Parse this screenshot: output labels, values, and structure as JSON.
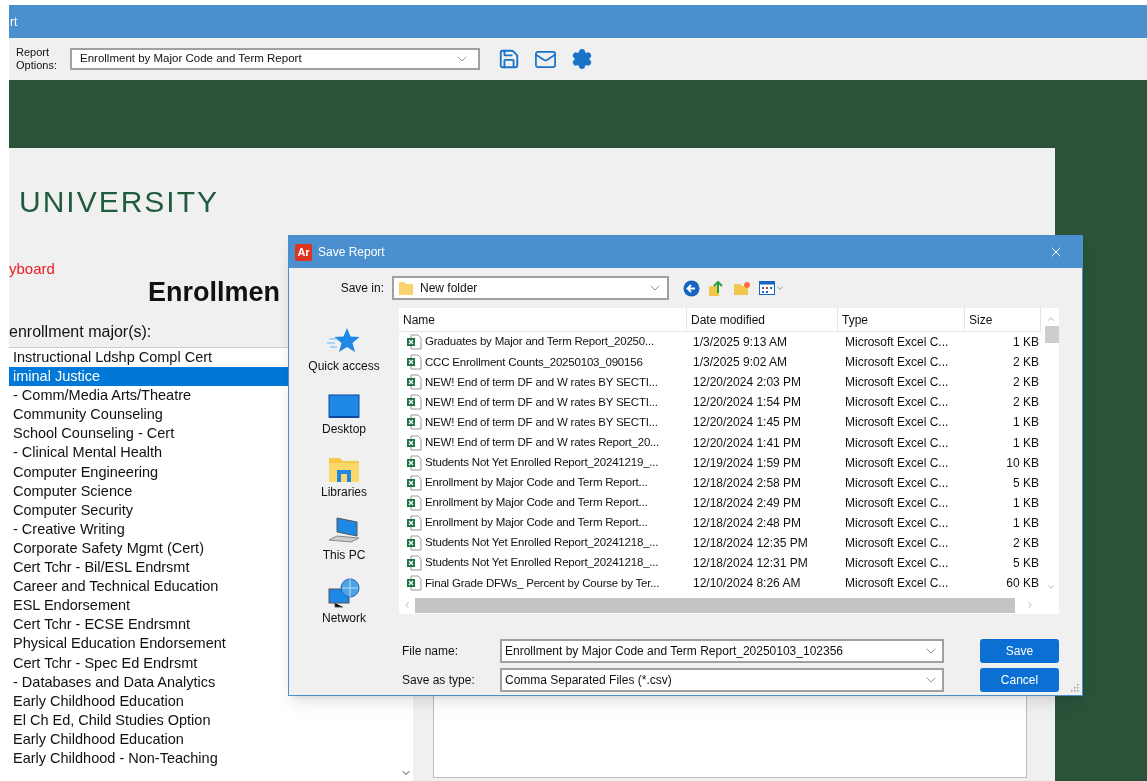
{
  "window": {
    "title": "rt"
  },
  "toolbar": {
    "report_options_label": "Report Options:",
    "report_select": "Enrollment by Major Code and Term Report"
  },
  "page": {
    "heading": "UNIVERSITY",
    "link": "yboard",
    "title": "Enrollmen",
    "majors_label": "enrollment major(s):",
    "majors": [
      {
        "label": "Instructional Ldshp Compl Cert",
        "selected": false
      },
      {
        "label": "iminal Justice",
        "selected": true
      },
      {
        "label": "- Comm/Media Arts/Theatre",
        "selected": false
      },
      {
        "label": "Community Counseling",
        "selected": false
      },
      {
        "label": "School Counseling - Cert",
        "selected": false
      },
      {
        "label": "- Clinical Mental Health",
        "selected": false
      },
      {
        "label": "Computer Engineering",
        "selected": false
      },
      {
        "label": "Computer Science",
        "selected": false
      },
      {
        "label": "Computer Security",
        "selected": false
      },
      {
        "label": "- Creative Writing",
        "selected": false
      },
      {
        "label": "Corporate Safety Mgmt (Cert)",
        "selected": false
      },
      {
        "label": "Cert Tchr - Bil/ESL Endrsmt",
        "selected": false
      },
      {
        "label": "Career and Technical Education",
        "selected": false
      },
      {
        "label": "ESL Endorsement",
        "selected": false
      },
      {
        "label": "Cert Tchr - ECSE Endrsmnt",
        "selected": false
      },
      {
        "label": "Physical Education Endorsement",
        "selected": false
      },
      {
        "label": "Cert Tchr - Spec Ed Endrsmt",
        "selected": false
      },
      {
        "label": "- Databases and Data Analytics",
        "selected": false
      },
      {
        "label": "Early Childhood Education",
        "selected": false
      },
      {
        "label": "El Ch Ed, Child Studies Option",
        "selected": false
      },
      {
        "label": "Early Childhood Education",
        "selected": false
      },
      {
        "label": "Early Childhood - Non-Teaching",
        "selected": false
      }
    ]
  },
  "dialog": {
    "app_icon": "Ar",
    "title": "Save Report",
    "save_in_label": "Save in:",
    "save_in": "New folder",
    "places": [
      {
        "label": "Quick access",
        "kind": "quick"
      },
      {
        "label": "Desktop",
        "kind": "desktop"
      },
      {
        "label": "Libraries",
        "kind": "libraries"
      },
      {
        "label": "This PC",
        "kind": "pc"
      },
      {
        "label": "Network",
        "kind": "network"
      }
    ],
    "columns": [
      "Name",
      "Date modified",
      "Type",
      "Size"
    ],
    "files": [
      {
        "name": "Graduates by Major and Term Report_20250...",
        "date": "1/3/2025 9:13 AM",
        "type": "Microsoft Excel C...",
        "size": "1 KB"
      },
      {
        "name": "CCC Enrollment Counts_20250103_090156",
        "date": "1/3/2025 9:02 AM",
        "type": "Microsoft Excel C...",
        "size": "2 KB"
      },
      {
        "name": "NEW! End of term DF and W rates BY SECTI...",
        "date": "12/20/2024 2:03 PM",
        "type": "Microsoft Excel C...",
        "size": "2 KB"
      },
      {
        "name": "NEW! End of term DF and W rates BY SECTI...",
        "date": "12/20/2024 1:54 PM",
        "type": "Microsoft Excel C...",
        "size": "2 KB"
      },
      {
        "name": "NEW! End of term DF and W rates BY SECTI...",
        "date": "12/20/2024 1:45 PM",
        "type": "Microsoft Excel C...",
        "size": "1 KB"
      },
      {
        "name": "NEW! End of term DF and W rates Report_20...",
        "date": "12/20/2024 1:41 PM",
        "type": "Microsoft Excel C...",
        "size": "1 KB"
      },
      {
        "name": "Students Not Yet Enrolled Report_20241219_...",
        "date": "12/19/2024 1:59 PM",
        "type": "Microsoft Excel C...",
        "size": "10 KB"
      },
      {
        "name": "Enrollment by Major Code and Term Report...",
        "date": "12/18/2024 2:58 PM",
        "type": "Microsoft Excel C...",
        "size": "5 KB"
      },
      {
        "name": "Enrollment by Major Code and Term Report...",
        "date": "12/18/2024 2:49 PM",
        "type": "Microsoft Excel C...",
        "size": "1 KB"
      },
      {
        "name": "Enrollment by Major Code and Term Report...",
        "date": "12/18/2024 2:48 PM",
        "type": "Microsoft Excel C...",
        "size": "1 KB"
      },
      {
        "name": "Students Not Yet Enrolled Report_20241218_...",
        "date": "12/18/2024 12:35 PM",
        "type": "Microsoft Excel C...",
        "size": "2 KB"
      },
      {
        "name": "Students Not Yet Enrolled Report_20241218_...",
        "date": "12/18/2024 12:31 PM",
        "type": "Microsoft Excel C...",
        "size": "5 KB"
      },
      {
        "name": "Final Grade DFWs_ Percent by Course by Ter...",
        "date": "12/10/2024 8:26 AM",
        "type": "Microsoft Excel C...",
        "size": "60 KB"
      }
    ],
    "file_name_label": "File name:",
    "file_name": "Enrollment by Major Code and Term Report_20250103_102356",
    "type_label": "Save as type:",
    "type_value": "Comma Separated Files (*.csv)",
    "buttons": [
      "Save",
      "Cancel"
    ]
  }
}
